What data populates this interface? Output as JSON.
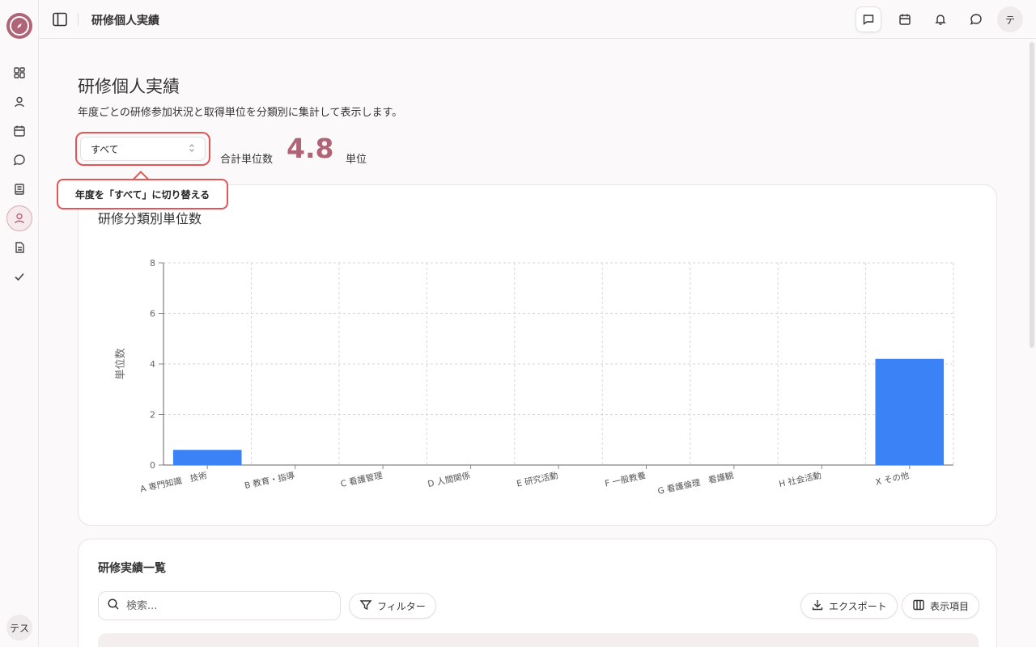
{
  "header": {
    "title": "研修個人実績",
    "avatar": "テ"
  },
  "sidebar": {
    "user": "テス"
  },
  "page": {
    "title": "研修個人実績",
    "description": "年度ごとの研修参加状況と取得単位を分類別に集計して表示します。"
  },
  "filter": {
    "year_selected": "すべて",
    "tooltip": "年度を「すべて」に切り替える"
  },
  "total": {
    "label": "合計単位数",
    "value": "4.8",
    "unit": "単位"
  },
  "colors": {
    "accent": "#b06477",
    "bar": "#3b82f6",
    "highlight": "#e25656"
  },
  "chart_data": {
    "type": "bar",
    "title": "研修分類別単位数",
    "ylabel": "単位数",
    "xlabel": "",
    "ylim": [
      0,
      8
    ],
    "yticks": [
      0,
      2,
      4,
      6,
      8
    ],
    "grid": true,
    "categories": [
      "A 専門知識　技術",
      "B 教育・指導",
      "C 看護管理",
      "D 人間関係",
      "E 研究活動",
      "F 一般教養",
      "G 看護倫理　看護観",
      "H 社会活動",
      "X その他"
    ],
    "values": [
      0.6,
      0,
      0,
      0,
      0,
      0,
      0,
      0,
      4.2
    ]
  },
  "list": {
    "title": "研修実績一覧",
    "search_placeholder": "検索...",
    "filter_label": "フィルター",
    "export_label": "エクスポート",
    "columns_label": "表示項目"
  }
}
